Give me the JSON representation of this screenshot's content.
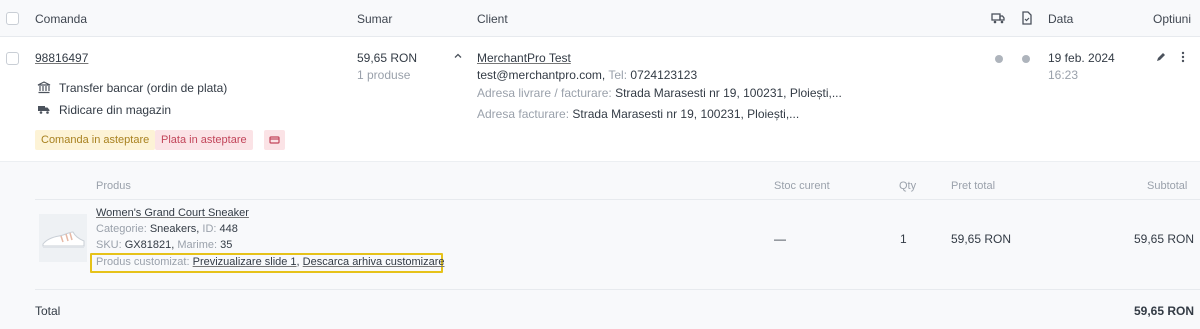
{
  "header": {
    "order": "Comanda",
    "summary": "Sumar",
    "client": "Client",
    "date": "Data",
    "options": "Optiuni",
    "shipping_icon": "truck-icon",
    "invoice_icon": "document-icon"
  },
  "order": {
    "id": "98816497",
    "payment_method": "Transfer bancar (ordin de plata)",
    "delivery_method": "Ridicare din magazin",
    "badges": {
      "order_status": "Comanda in asteptare",
      "payment_status": "Plata in asteptare"
    },
    "total": "59,65 RON",
    "products_count": "1 produse",
    "client": {
      "name": "MerchantPro Test",
      "email": "test@merchantpro.com,",
      "tel_label": "Tel:",
      "tel": "0724123123",
      "address_label": "Adresa livrare / facturare:",
      "address": "Strada Marasesti nr 19, 100231, Ploiești,...",
      "billing_label": "Adresa facturare:",
      "billing_address": "Strada Marasesti nr 19, 100231, Ploiești,..."
    },
    "date": "19 feb. 2024",
    "time": "16:23"
  },
  "products_table": {
    "headers": {
      "product": "Produs",
      "stock": "Stoc curent",
      "qty": "Qty",
      "total_price": "Pret total",
      "subtotal": "Subtotal"
    },
    "rows": [
      {
        "name": "Women's Grand Court Sneaker",
        "category_label": "Categorie:",
        "category": "Sneakers,",
        "id_label": "ID:",
        "id": "448",
        "sku_label": "SKU:",
        "sku": "GX81821,",
        "size_label": "Marime:",
        "size": "35",
        "custom_label": "Produs customizat:",
        "preview_link": "Previzualizare slide 1",
        "archive_link": "Descarca arhiva customizare",
        "stock": "—",
        "qty": "1",
        "total_price": "59,65 RON",
        "subtotal": "59,65 RON"
      }
    ],
    "total_label": "Total",
    "total_value": "59,65 RON"
  },
  "colors": {
    "order_badge_bg": "#fdf3d6",
    "order_badge_text": "#a8811f",
    "payment_badge_bg": "#fbe3e6",
    "payment_badge_text": "#c2455a",
    "highlight": "#e6c21a"
  }
}
